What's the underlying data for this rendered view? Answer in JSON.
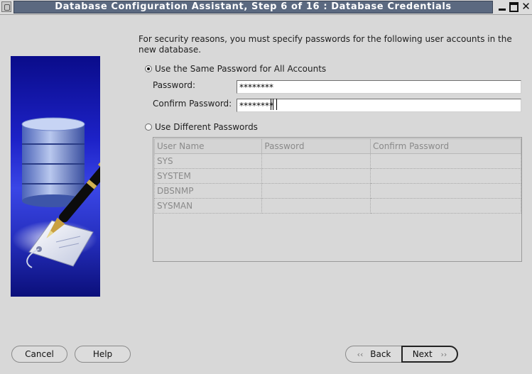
{
  "window": {
    "title": "Database Configuration Assistant, Step 6 of 16 : Database Credentials",
    "minimize_icon": "minimize-icon",
    "maximize_icon": "maximize-icon",
    "close_glyph": "✕"
  },
  "intro_text": "For security reasons, you must specify passwords for the following user accounts in the new database.",
  "same_password": {
    "option_label": "Use the Same Password for All Accounts",
    "selected": true,
    "password_label": "Password:",
    "password_value": "********",
    "confirm_label": "Confirm Password:",
    "confirm_value": "********"
  },
  "different_passwords": {
    "option_label": "Use Different Passwords",
    "selected": false,
    "columns": [
      "User Name",
      "Password",
      "Confirm Password"
    ],
    "rows": [
      {
        "user": "SYS",
        "password": "",
        "confirm": ""
      },
      {
        "user": "SYSTEM",
        "password": "",
        "confirm": ""
      },
      {
        "user": "DBSNMP",
        "password": "",
        "confirm": ""
      },
      {
        "user": "SYSMAN",
        "password": "",
        "confirm": ""
      }
    ]
  },
  "buttons": {
    "cancel": "Cancel",
    "help": "Help",
    "back": "Back",
    "next": "Next",
    "back_icon": "‹‹",
    "next_icon": "››"
  },
  "colors": {
    "title_bar": "#5b6980",
    "graphic_blue": "#1d22c8",
    "background": "#d8d8d8"
  }
}
